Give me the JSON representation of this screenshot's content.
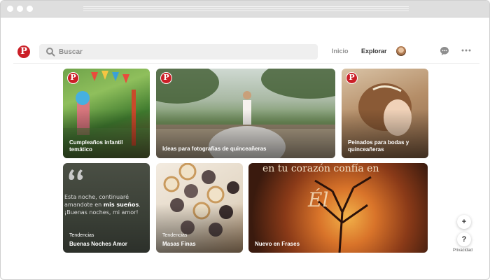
{
  "header": {
    "logo": "P",
    "search": {
      "placeholder": "Buscar"
    },
    "nav": {
      "inicio": "Inicio",
      "explorar": "Explorar"
    }
  },
  "tiles": [
    {
      "caption": "Cumpleaños infantil temático",
      "badge": "P"
    },
    {
      "caption": "Ideas para fotografías de quinceañeras",
      "badge": "P"
    },
    {
      "caption": "Peinados para bodas y quinceañeras",
      "badge": "P"
    },
    {
      "kicker": "Tendencias",
      "caption": "Buenas Noches Amor",
      "quote_a": "Esta noche, continuaré amandote en ",
      "quote_b": "mis sueños",
      "quote_c": ". ¡Buenas noches, mi amor!"
    },
    {
      "kicker": "Tendencias",
      "caption": "Masas Finas"
    },
    {
      "caption": "Nuevo en Frases",
      "script": "en tu corazón confía en"
    }
  ],
  "floating": {
    "plus": "+",
    "help": "?",
    "privacy": "Privacidad"
  },
  "colors": {
    "brand": "#cb1f27",
    "nav_active": "#333333",
    "nav_inactive": "#8e8e8e"
  }
}
